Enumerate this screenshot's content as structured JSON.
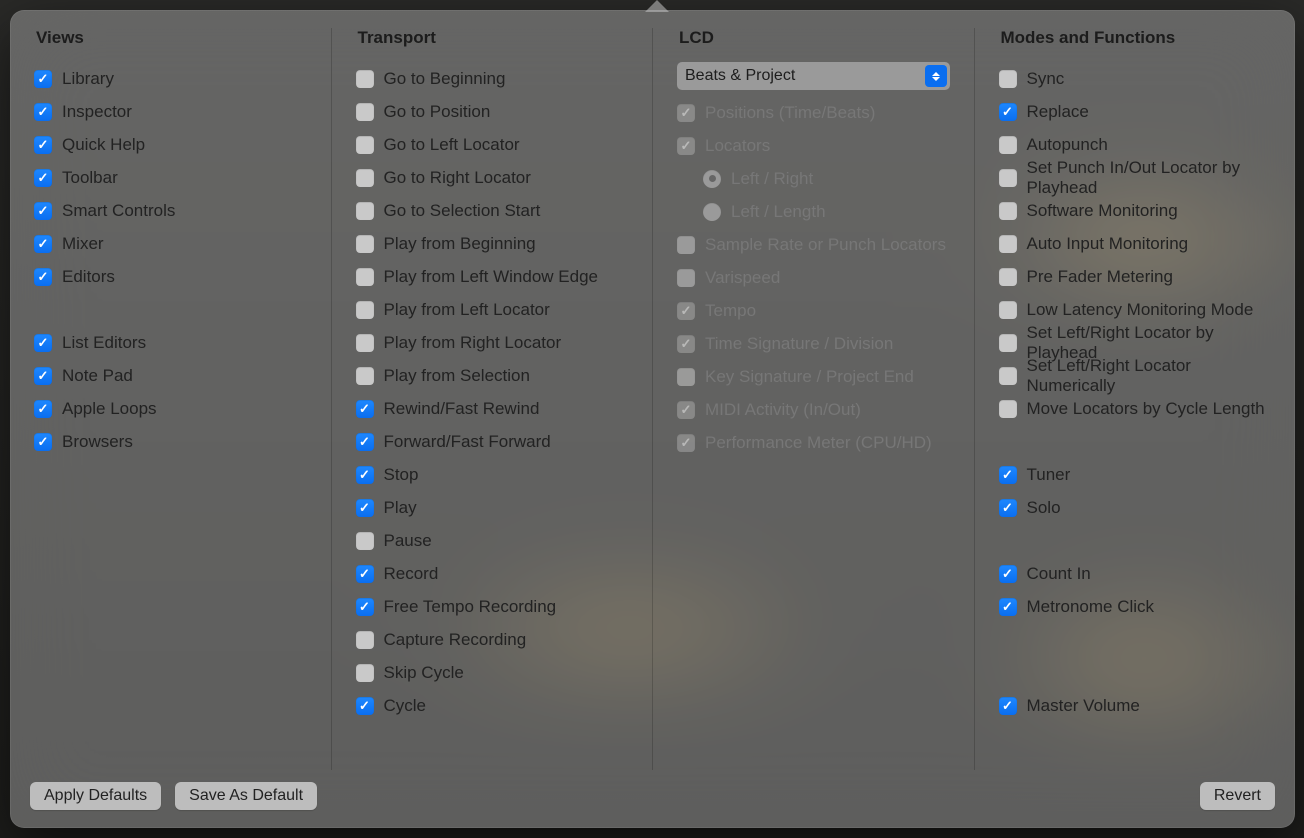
{
  "views": {
    "title": "Views",
    "items": [
      {
        "label": "Library",
        "checked": true
      },
      {
        "label": "Inspector",
        "checked": true
      },
      {
        "label": "Quick Help",
        "checked": true
      },
      {
        "label": "Toolbar",
        "checked": true
      },
      {
        "label": "Smart Controls",
        "checked": true
      },
      {
        "label": "Mixer",
        "checked": true
      },
      {
        "label": "Editors",
        "checked": true
      }
    ],
    "items2": [
      {
        "label": "List Editors",
        "checked": true
      },
      {
        "label": "Note Pad",
        "checked": true
      },
      {
        "label": "Apple Loops",
        "checked": true
      },
      {
        "label": "Browsers",
        "checked": true
      }
    ]
  },
  "transport": {
    "title": "Transport",
    "items": [
      {
        "label": "Go to Beginning",
        "checked": false
      },
      {
        "label": "Go to Position",
        "checked": false
      },
      {
        "label": "Go to Left Locator",
        "checked": false
      },
      {
        "label": "Go to Right Locator",
        "checked": false
      },
      {
        "label": "Go to Selection Start",
        "checked": false
      },
      {
        "label": "Play from Beginning",
        "checked": false
      },
      {
        "label": "Play from Left Window Edge",
        "checked": false
      },
      {
        "label": "Play from Left Locator",
        "checked": false
      },
      {
        "label": "Play from Right Locator",
        "checked": false
      },
      {
        "label": "Play from Selection",
        "checked": false
      },
      {
        "label": "Rewind/Fast Rewind",
        "checked": true
      },
      {
        "label": "Forward/Fast Forward",
        "checked": true
      },
      {
        "label": "Stop",
        "checked": true
      },
      {
        "label": "Play",
        "checked": true
      },
      {
        "label": "Pause",
        "checked": false
      },
      {
        "label": "Record",
        "checked": true
      },
      {
        "label": "Free Tempo Recording",
        "checked": true
      },
      {
        "label": "Capture Recording",
        "checked": false
      },
      {
        "label": "Skip Cycle",
        "checked": false
      },
      {
        "label": "Cycle",
        "checked": true
      }
    ]
  },
  "lcd": {
    "title": "LCD",
    "select_value": "Beats & Project",
    "items": [
      {
        "label": "Positions (Time/Beats)",
        "checked": true,
        "disabled": true,
        "type": "checkbox"
      },
      {
        "label": "Locators",
        "checked": true,
        "disabled": true,
        "type": "checkbox"
      },
      {
        "label": "Left / Right",
        "checked": true,
        "disabled": true,
        "type": "radio",
        "indent": true
      },
      {
        "label": "Left / Length",
        "checked": false,
        "disabled": true,
        "type": "radio",
        "indent": true
      },
      {
        "label": "Sample Rate or Punch Locators",
        "checked": false,
        "disabled": true,
        "type": "checkbox"
      },
      {
        "label": "Varispeed",
        "checked": false,
        "disabled": true,
        "type": "checkbox"
      },
      {
        "label": "Tempo",
        "checked": true,
        "disabled": true,
        "type": "checkbox"
      },
      {
        "label": "Time Signature / Division",
        "checked": true,
        "disabled": true,
        "type": "checkbox"
      },
      {
        "label": "Key Signature / Project End",
        "checked": false,
        "disabled": true,
        "type": "checkbox"
      },
      {
        "label": "MIDI Activity (In/Out)",
        "checked": true,
        "disabled": true,
        "type": "checkbox"
      },
      {
        "label": "Performance Meter (CPU/HD)",
        "checked": true,
        "disabled": true,
        "type": "checkbox"
      }
    ]
  },
  "modes": {
    "title": "Modes and Functions",
    "g1": [
      {
        "label": "Sync",
        "checked": false
      },
      {
        "label": "Replace",
        "checked": true
      },
      {
        "label": "Autopunch",
        "checked": false
      },
      {
        "label": "Set Punch In/Out Locator by Playhead",
        "checked": false
      },
      {
        "label": "Software Monitoring",
        "checked": false
      },
      {
        "label": "Auto Input Monitoring",
        "checked": false
      },
      {
        "label": "Pre Fader Metering",
        "checked": false
      },
      {
        "label": "Low Latency Monitoring Mode",
        "checked": false
      },
      {
        "label": "Set Left/Right Locator by Playhead",
        "checked": false
      },
      {
        "label": "Set Left/Right Locator Numerically",
        "checked": false
      },
      {
        "label": "Move Locators by Cycle Length",
        "checked": false
      }
    ],
    "g2": [
      {
        "label": "Tuner",
        "checked": true
      },
      {
        "label": "Solo",
        "checked": true
      }
    ],
    "g3": [
      {
        "label": "Count In",
        "checked": true
      },
      {
        "label": "Metronome Click",
        "checked": true
      }
    ],
    "g4": [
      {
        "label": "Master Volume",
        "checked": true
      }
    ]
  },
  "buttons": {
    "apply_defaults": "Apply Defaults",
    "save_as_default": "Save As Default",
    "revert": "Revert"
  }
}
